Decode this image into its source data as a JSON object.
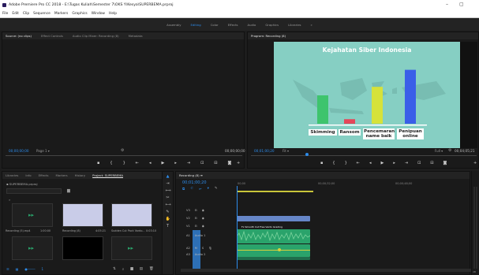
{
  "window": {
    "title": "Adobe Premiere Pro CC 2018 - E:\\Tugas Kuliah\\Semester 7\\OKS Y\\Kesya\\SUPERBEMA.prproj",
    "minimize": "–",
    "maximize": "▢"
  },
  "menu": [
    "File",
    "Edit",
    "Clip",
    "Sequence",
    "Markers",
    "Graphics",
    "Window",
    "Help"
  ],
  "workspaces": {
    "items": [
      "Assembly",
      "Editing",
      "Color",
      "Effects",
      "Audio",
      "Graphics",
      "Libraries"
    ],
    "active": "Editing",
    "more": "»"
  },
  "source_panel": {
    "tabs": [
      "Source: (no clips)",
      "Effect Controls",
      "Audio Clip Mixer: Recording (8)",
      "Metadata"
    ],
    "timecode_left": "00;00;00;00",
    "page": "Page 1",
    "timecode_right": "00;00;00;00"
  },
  "program_panel": {
    "tab": "Program: Recording (8)",
    "timecode_left": "00;01;00;20",
    "fit": "Fit",
    "full": "Full",
    "timecode_right": "00;04;05;21"
  },
  "video_frame": {
    "title": "Kejahatan Siber Indonesia",
    "bg_color": "#86cfc3",
    "chart_data": {
      "type": "bar",
      "categories": [
        "Skimming",
        "Ransom",
        "Pencemaran name baik",
        "Penipuan online"
      ],
      "labels": [
        "Skimming",
        "Ransom",
        "Pencemaran\nname baik",
        "Penipuan\nonline"
      ],
      "values": [
        50,
        8,
        65,
        95
      ],
      "colors": [
        "#3ec46d",
        "#e5475a",
        "#d6e23a",
        "#3a5ee8"
      ]
    }
  },
  "project_panel": {
    "tabs": [
      "Libraries",
      "Info",
      "Effects",
      "Markers",
      "History",
      "Project: SUPERBEMA"
    ],
    "project_file": "SUPERBEMA.prproj",
    "search_placeholder": "",
    "items": [
      {
        "name": "Recording (5).mp4",
        "duration": "1:00:00"
      },
      {
        "name": "Recording (8)",
        "duration": "4:05:21"
      },
      {
        "name": "Sudden Cut Pack Vardo...",
        "duration": "0:03:10"
      }
    ],
    "zoom": "1"
  },
  "timeline": {
    "tab": "Recording (8)",
    "timecode": "00;01;00;20",
    "ruler": [
      "00;00",
      "00;00;32;00",
      "00;00;48;00"
    ],
    "title_clip": "Fx Smooth Cut Free Vardo Grading",
    "tracks": [
      {
        "name": "V3"
      },
      {
        "name": "V2"
      },
      {
        "name": "V1"
      },
      {
        "name": "A1",
        "label": "Audio 1"
      },
      {
        "name": "A2",
        "label": "Audio 2"
      },
      {
        "name": "A3",
        "label": "Audio 3"
      }
    ],
    "meter_db": "dB"
  },
  "colors": {
    "accent": "#2d8ceb",
    "panel_bg": "#1a1a1a",
    "audio_clip": "#2aa36b",
    "video_clip": "#6686c7"
  }
}
